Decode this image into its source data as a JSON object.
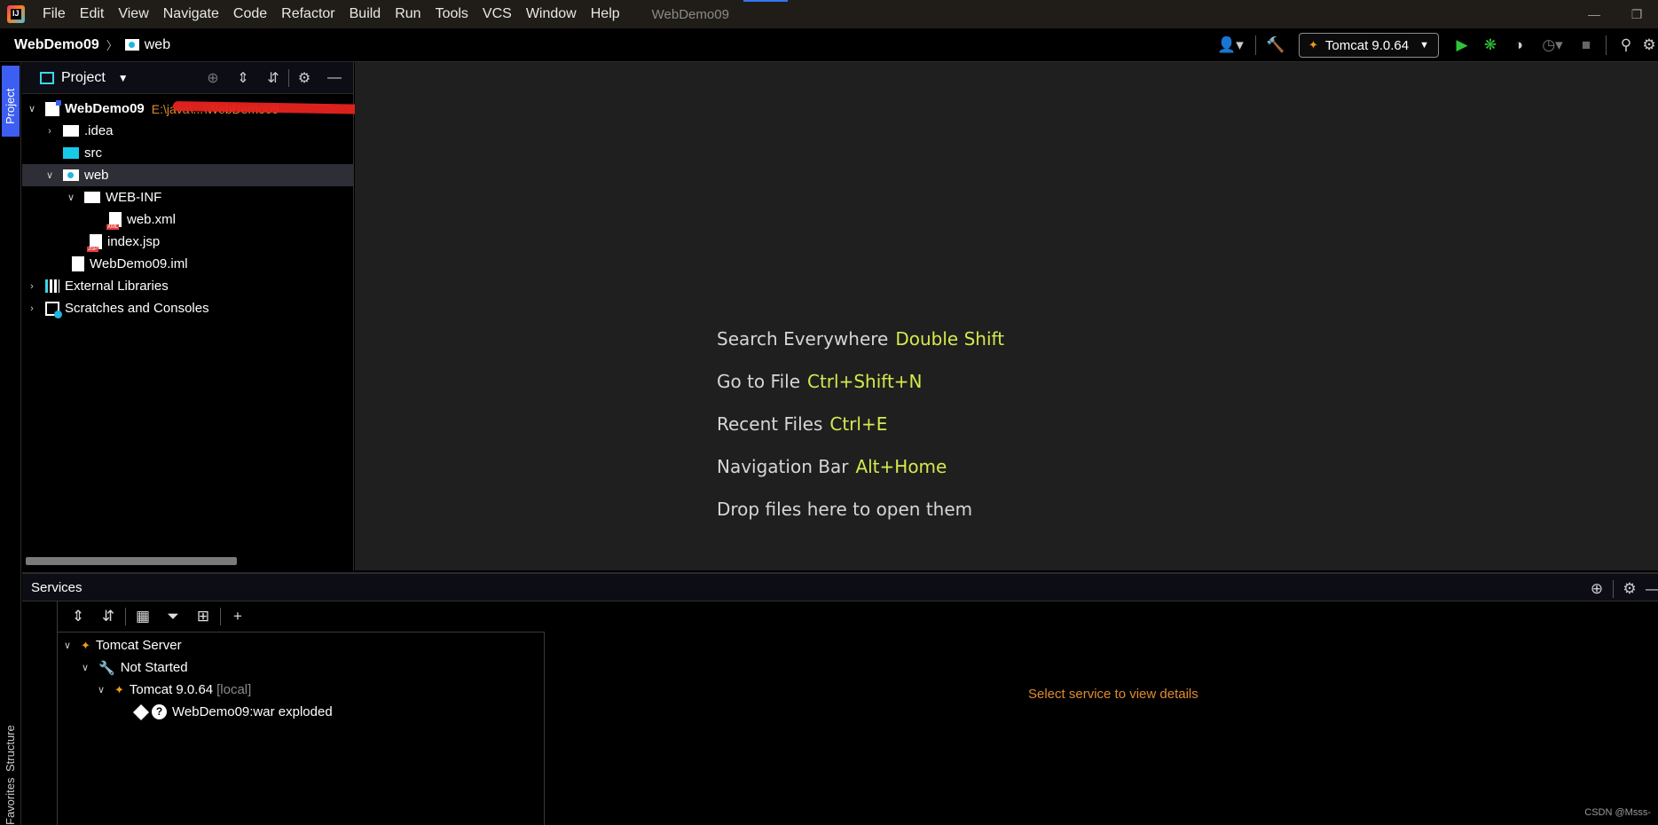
{
  "menubar": {
    "logo_text": "IJ",
    "items": [
      {
        "label": "File"
      },
      {
        "label": "Edit"
      },
      {
        "label": "View"
      },
      {
        "label": "Navigate"
      },
      {
        "label": "Code"
      },
      {
        "label": "Refactor"
      },
      {
        "label": "Build"
      },
      {
        "label": "Run"
      },
      {
        "label": "Tools"
      },
      {
        "label": "VCS"
      },
      {
        "label": "Window"
      },
      {
        "label": "Help"
      }
    ],
    "window_title": "WebDemo09"
  },
  "navbar": {
    "breadcrumb_root": "WebDemo09",
    "breadcrumb_sep": "〉",
    "breadcrumb_current": "web",
    "run_config": "Tomcat 9.0.64"
  },
  "left_strip": {
    "project_tab": "Project",
    "structure_tab": "Structure",
    "favorites_tab": "Favorites"
  },
  "project_panel": {
    "title": "Project",
    "tree": {
      "root_name": "WebDemo09",
      "root_path": "E:\\java\\...\\WebDemo09",
      "idea": ".idea",
      "src": "src",
      "web": "web",
      "web_inf": "WEB-INF",
      "web_xml": "web.xml",
      "index_jsp": "index.jsp",
      "iml": "WebDemo09.iml",
      "external_libraries": "External Libraries",
      "scratches": "Scratches and Consoles"
    }
  },
  "editor": {
    "hints": [
      {
        "label": "Search Everywhere",
        "shortcut": "Double Shift"
      },
      {
        "label": "Go to File",
        "shortcut": "Ctrl+Shift+N"
      },
      {
        "label": "Recent Files",
        "shortcut": "Ctrl+E"
      },
      {
        "label": "Navigation Bar",
        "shortcut": "Alt+Home"
      },
      {
        "label": "Drop files here to open them",
        "shortcut": ""
      }
    ]
  },
  "services": {
    "title": "Services",
    "tree": {
      "tomcat_server": "Tomcat Server",
      "not_started": "Not Started",
      "tomcat_instance": "Tomcat 9.0.64",
      "tomcat_local": "[local]",
      "artifact": "WebDemo09:war exploded"
    },
    "detail_message": "Select service to view details"
  },
  "watermark": "CSDN @Msss-",
  "colors": {
    "accent_blue": "#3d5ef2",
    "shortcut_yellow": "#d6e94d",
    "path_orange": "#e08b2d",
    "run_green": "#2fc43a"
  }
}
